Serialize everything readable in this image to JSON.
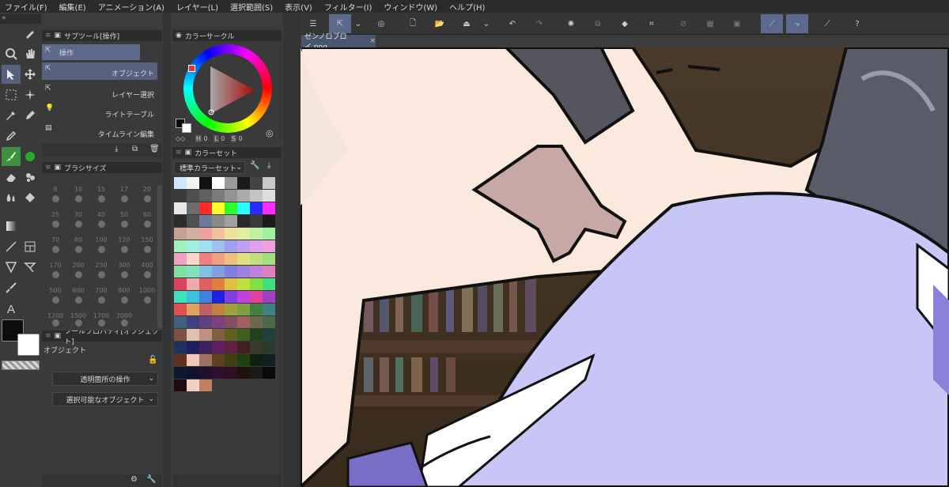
{
  "menu": [
    "ファイル(F)",
    "編集(E)",
    "アニメーション(A)",
    "レイヤー(L)",
    "選択範囲(S)",
    "表示(V)",
    "フィルター(I)",
    "ウィンドウ(W)",
    "ヘルプ(H)"
  ],
  "subtool": {
    "header": "サブツール[操作]",
    "group": "操作",
    "items": [
      "オブジェクト",
      "レイヤー選択",
      "ライトテーブル",
      "タイムライン編集"
    ]
  },
  "brush_size": {
    "header": "ブラシサイズ",
    "sizes": [
      "8",
      "10",
      "15",
      "17",
      "20",
      "25",
      "30",
      "40",
      "50",
      "60",
      "70",
      "80",
      "100",
      "120",
      "150",
      "170",
      "200",
      "250",
      "300",
      "400",
      "500",
      "600",
      "700",
      "800",
      "1000",
      "1200",
      "1500",
      "1700",
      "2000"
    ]
  },
  "tool_property": {
    "header": "ツールプロパティ[オブジェクト]",
    "name": "オブジェクト",
    "options": [
      "透明箇所の操作",
      "選択可能なオブジェクト"
    ]
  },
  "color_circle": {
    "header": "カラーサークル",
    "hsv": [
      "H",
      "0",
      "L",
      "0",
      "S",
      "0"
    ]
  },
  "color_set": {
    "header": "カラーセット",
    "selected": "標準カラーセット"
  },
  "document": {
    "tab_label": "ゼンノロブロイ.png"
  },
  "colors": {
    "accent": "#5a6a8c",
    "main_color": "#0d0d0d",
    "sub_color": "#ffffff"
  }
}
